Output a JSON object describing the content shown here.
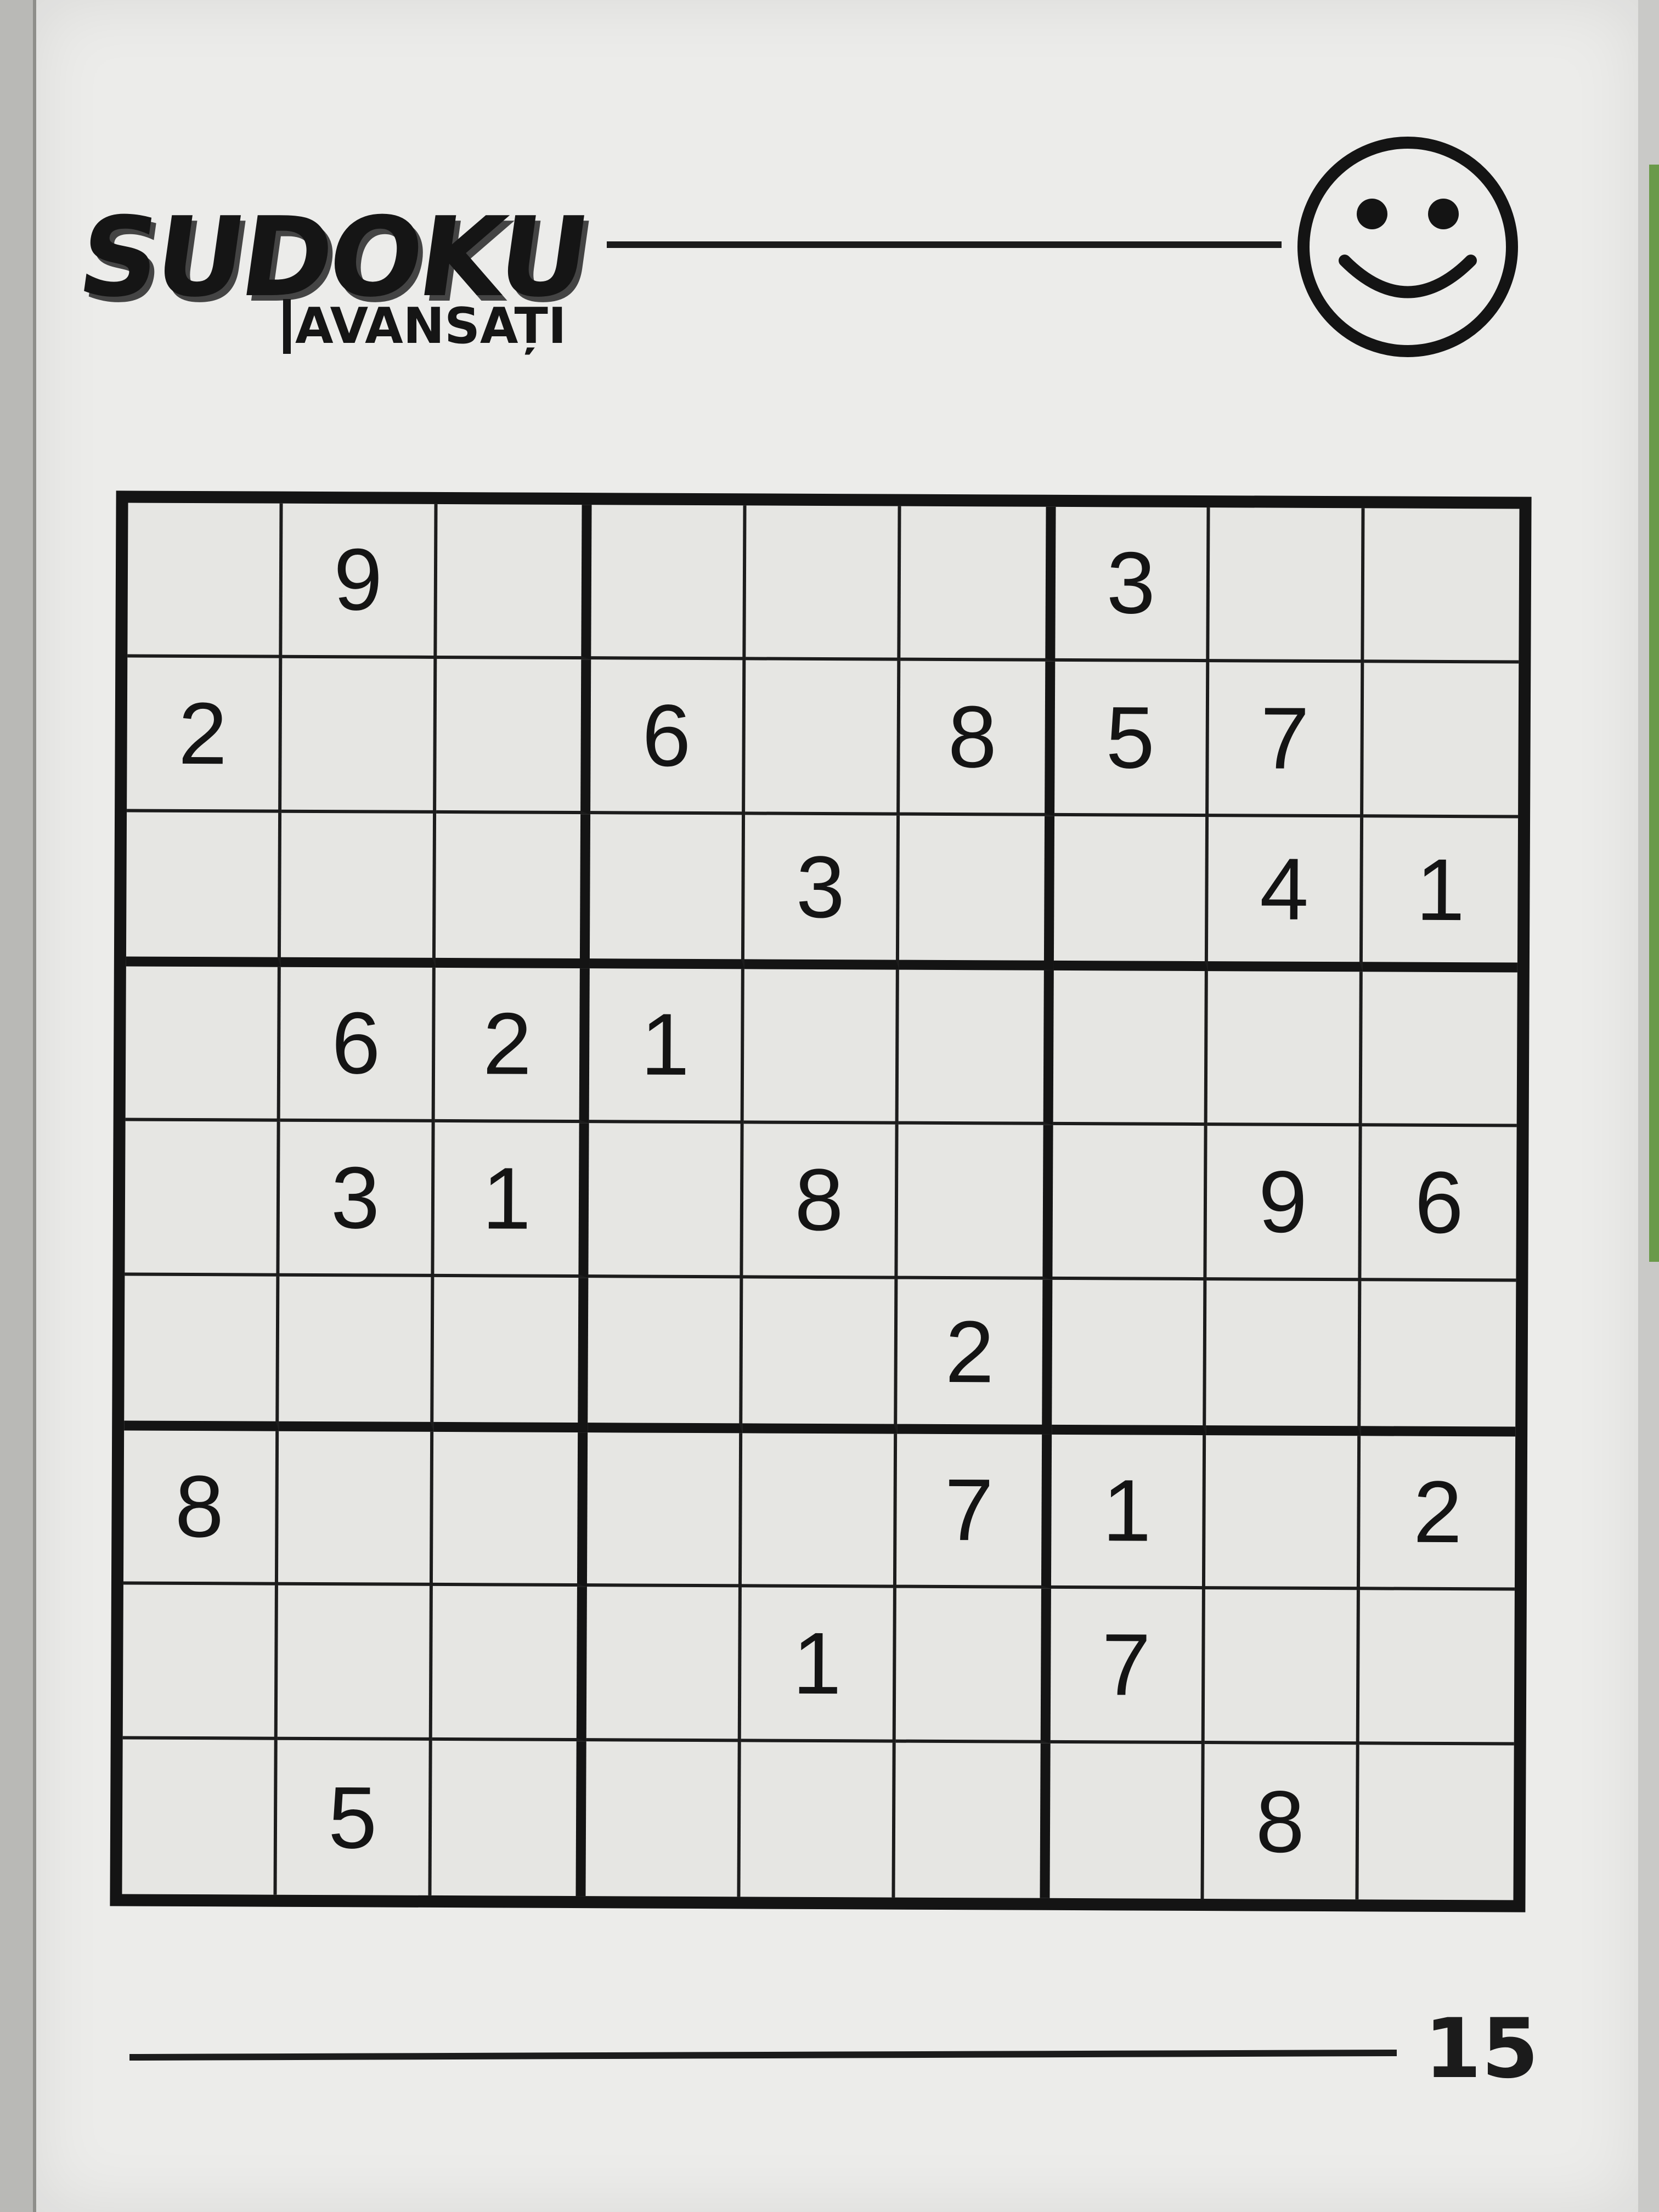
{
  "header": {
    "title": "SUDOKU",
    "subtitle": "AVANSAȚI"
  },
  "icons": {
    "smiley": "smiley-face-icon"
  },
  "puzzle": {
    "grid": [
      [
        "",
        "9",
        "",
        "",
        "",
        "",
        "3",
        "",
        ""
      ],
      [
        "2",
        "",
        "",
        "6",
        "",
        "8",
        "5",
        "7",
        ""
      ],
      [
        "",
        "",
        "",
        "",
        "3",
        "",
        "",
        "4",
        "1"
      ],
      [
        "",
        "6",
        "2",
        "1",
        "",
        "",
        "",
        "",
        ""
      ],
      [
        "",
        "3",
        "1",
        "",
        "8",
        "",
        "",
        "9",
        "6"
      ],
      [
        "",
        "",
        "",
        "",
        "",
        "2",
        "",
        "",
        ""
      ],
      [
        "8",
        "",
        "",
        "",
        "",
        "7",
        "1",
        "",
        "2"
      ],
      [
        "",
        "",
        "",
        "",
        "1",
        "",
        "7",
        "",
        ""
      ],
      [
        "",
        "5",
        "",
        "",
        "",
        "",
        "",
        "8",
        ""
      ]
    ]
  },
  "footer": {
    "page_number": "15"
  }
}
